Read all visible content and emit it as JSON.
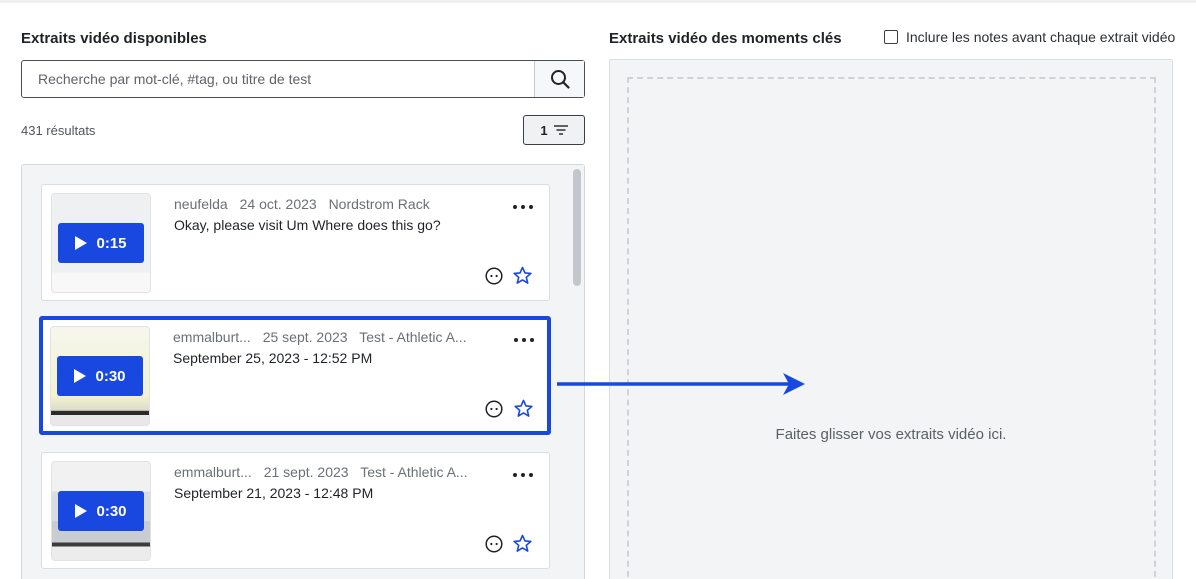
{
  "left_panel": {
    "title": "Extraits vidéo disponibles",
    "search_placeholder": "Recherche par mot-clé, #tag, ou titre de test",
    "results_count": "431 résultats",
    "filter_count": "1"
  },
  "right_panel": {
    "title": "Extraits vidéo des moments clés",
    "include_notes_label": "Inclure les notes avant chaque extrait vidéo",
    "include_notes_checked": false,
    "drop_hint": "Faites glisser vos extraits vidéo ici."
  },
  "clips": [
    {
      "duration": "0:15",
      "user": "neufelda",
      "date": "24 oct. 2023",
      "test": "Nordstrom Rack",
      "description": "Okay, please visit Um Where does this go?",
      "selected": false
    },
    {
      "duration": "0:30",
      "user": "emmalburt...",
      "date": "25 sept. 2023",
      "test": "Test - Athletic A...",
      "description": "September 25, 2023 - 12:52 PM",
      "selected": true
    },
    {
      "duration": "0:30",
      "user": "emmalburt...",
      "date": "21 sept. 2023",
      "test": "Test - Athletic A...",
      "description": "September 21, 2023 - 12:48 PM",
      "selected": false
    }
  ],
  "colors": {
    "accent": "#1948e0",
    "panel_bg": "#f2f4f5"
  },
  "icons": {
    "search": "search-icon",
    "filter": "filter-icon",
    "play": "play-icon",
    "more": "more-options-icon",
    "emoji": "emoji-reaction-icon",
    "star": "star-icon",
    "arrow": "arrow-right-icon"
  }
}
